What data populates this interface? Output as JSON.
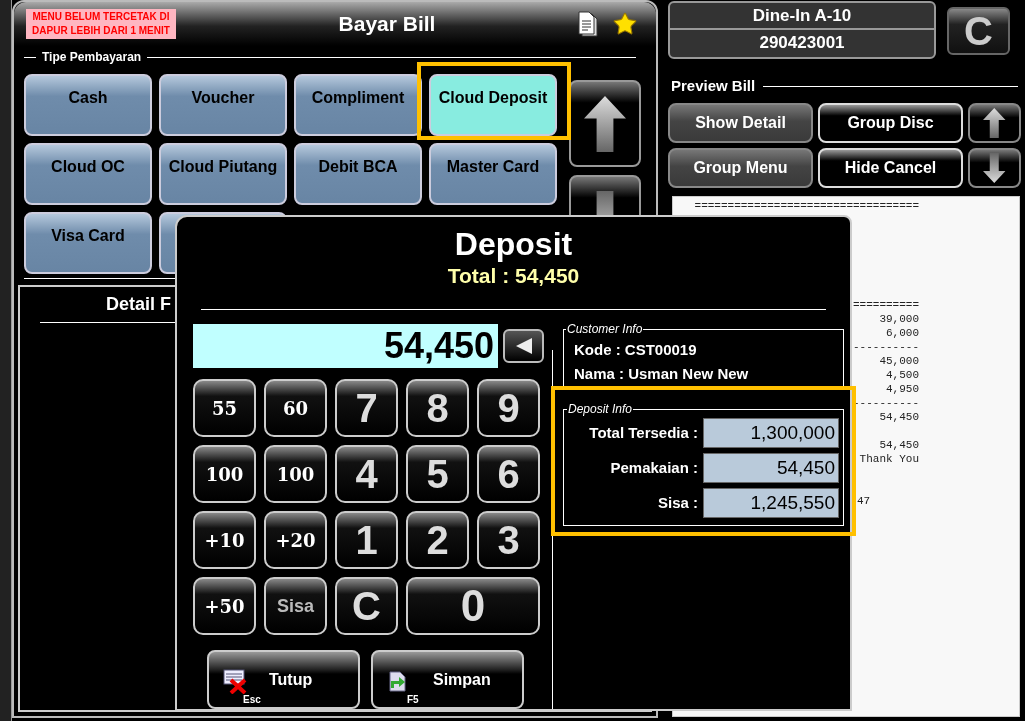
{
  "bill_window": {
    "notice": "MENU BELUM TERCETAK DI DAPUR LEBIH DARI 1 MENIT",
    "title": "Bayar Bill",
    "section_label": "Tipe Pembayaran",
    "payment_types": [
      {
        "label": "Cash",
        "selected": false,
        "highlighted": false
      },
      {
        "label": "Voucher",
        "selected": false,
        "highlighted": false
      },
      {
        "label": "Compliment",
        "selected": false,
        "highlighted": false
      },
      {
        "label": "Cloud Deposit",
        "selected": true,
        "highlighted": true
      },
      {
        "label": "Cloud OC",
        "selected": false,
        "highlighted": false
      },
      {
        "label": "Cloud Piutang",
        "selected": false,
        "highlighted": false
      },
      {
        "label": "Debit BCA",
        "selected": false,
        "highlighted": false
      },
      {
        "label": "Master Card",
        "selected": false,
        "highlighted": false
      },
      {
        "label": "Visa Card",
        "selected": false,
        "highlighted": false
      }
    ],
    "detail_heading": "Detail F"
  },
  "order": {
    "table": "Dine-In A-10",
    "number": "290423001",
    "clear_key": "C"
  },
  "preview": {
    "label": "Preview Bill",
    "buttons": [
      {
        "label": "Show Detail",
        "kind": "grey"
      },
      {
        "label": "Group Disc",
        "kind": "black"
      },
      {
        "label": "Group Menu",
        "kind": "grey"
      },
      {
        "label": "Hide Cancel",
        "kind": "black"
      }
    ]
  },
  "receipt": {
    "lines": [
      {
        "text": "==================================",
        "kind": "amount"
      },
      {
        "text": "==========",
        "kind": "amount"
      },
      {
        "text": "39,000",
        "kind": "amount"
      },
      {
        "text": "6,000",
        "kind": "amount"
      },
      {
        "text": "----------",
        "kind": "amount"
      },
      {
        "text": "45,000",
        "kind": "amount"
      },
      {
        "text": "4,500",
        "kind": "amount"
      },
      {
        "text": "4,950",
        "kind": "amount"
      },
      {
        "text": "----------",
        "kind": "amount"
      },
      {
        "text": "54,450",
        "kind": "amount"
      },
      {
        "text": "54,450",
        "kind": "amount"
      },
      {
        "text": "Thank You",
        "kind": "amount"
      },
      {
        "text": "47",
        "kind": "fragment"
      }
    ]
  },
  "deposit_dialog": {
    "title": "Deposit",
    "total": "Total : 54,450",
    "amount": "54,450",
    "keys": [
      {
        "label": "55",
        "kind": "quick"
      },
      {
        "label": "60",
        "kind": "quick"
      },
      {
        "label": "7",
        "kind": "digit"
      },
      {
        "label": "8",
        "kind": "digit"
      },
      {
        "label": "9",
        "kind": "digit"
      },
      {
        "label": "100",
        "kind": "quick"
      },
      {
        "label": "100",
        "kind": "quick"
      },
      {
        "label": "4",
        "kind": "digit"
      },
      {
        "label": "5",
        "kind": "digit"
      },
      {
        "label": "6",
        "kind": "digit"
      },
      {
        "label": "+10",
        "kind": "quick"
      },
      {
        "label": "+20",
        "kind": "quick"
      },
      {
        "label": "1",
        "kind": "digit"
      },
      {
        "label": "2",
        "kind": "digit"
      },
      {
        "label": "3",
        "kind": "digit"
      },
      {
        "label": "+50",
        "kind": "quick"
      },
      {
        "label": "Sisa",
        "kind": "word"
      },
      {
        "label": "C",
        "kind": "digit"
      },
      {
        "label": "0",
        "kind": "wide"
      }
    ],
    "customer_info": {
      "legend": "Customer Info",
      "lines": [
        "Kode : CST00019",
        "Nama : Usman New New"
      ]
    },
    "deposit_info": {
      "legend": "Deposit Info",
      "highlighted": true,
      "rows": [
        {
          "label": "Total Tersedia :",
          "value": "1,300,000"
        },
        {
          "label": "Pemakaian :",
          "value": "54,450"
        },
        {
          "label": "Sisa :",
          "value": "1,245,550"
        }
      ]
    },
    "actions": [
      {
        "label": "Tutup",
        "shortcut": "Esc",
        "kind": "close"
      },
      {
        "label": "Simpan",
        "shortcut": "F5",
        "kind": "save"
      }
    ]
  }
}
